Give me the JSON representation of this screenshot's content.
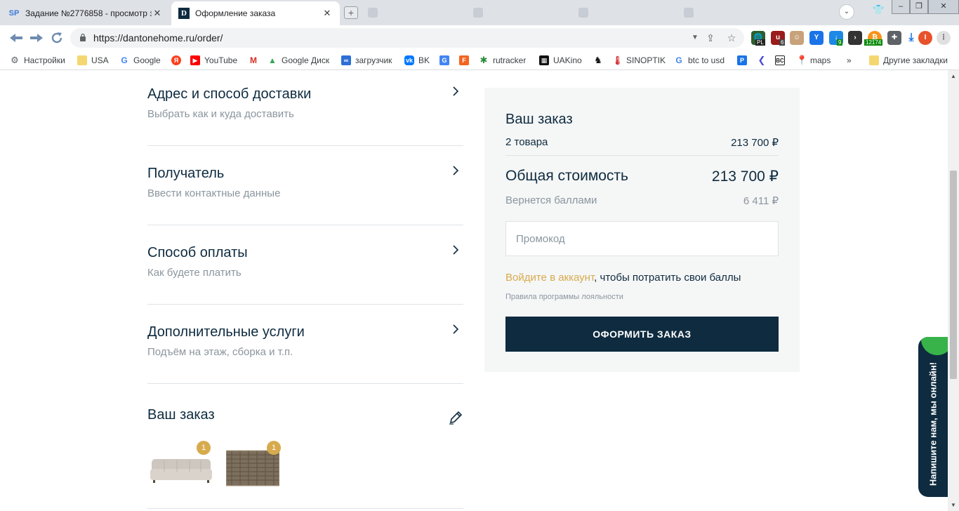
{
  "browser": {
    "tabs": [
      {
        "favicon": "SP",
        "title": "Задание №2776858 - просмотр з",
        "close": "✕"
      },
      {
        "favicon": "D",
        "title": "Оформление заказа",
        "close": "✕"
      }
    ],
    "url": "https://dantonehome.ru/order/",
    "ext_badges": {
      "pl": "PL",
      "six": "6",
      "nine": "9",
      "counter": "12174"
    },
    "bookmarks": [
      "Настройки",
      "USA",
      "Google",
      "YouTube",
      "Google Диск",
      "загрузчик",
      "BK",
      "rutracker",
      "UAKino",
      "SINOPTIK",
      "btc to usd",
      "maps",
      "Другие закладки"
    ],
    "bookmarks_more": "»"
  },
  "checkout": {
    "sections": [
      {
        "title": "Адрес и способ доставки",
        "subtitle": "Выбрать как и куда доставить"
      },
      {
        "title": "Получатель",
        "subtitle": "Ввести контактные данные"
      },
      {
        "title": "Способ оплаты",
        "subtitle": "Как будете платить"
      },
      {
        "title": "Дополнительные услуги",
        "subtitle": "Подъём на этаж, сборка и т.п."
      }
    ],
    "order": {
      "title": "Ваш заказ",
      "items": [
        {
          "icon": "sofa-thumbnail",
          "qty": "1"
        },
        {
          "icon": "rug-thumbnail",
          "qty": "1"
        }
      ]
    }
  },
  "summary": {
    "title": "Ваш заказ",
    "items_label": "2 товара",
    "items_price": "213 700 ₽",
    "total_label": "Общая стоимость",
    "total_price": "213 700 ₽",
    "bonus_label": "Вернется баллами",
    "bonus_value": "6 411 ₽",
    "promo_placeholder": "Промокод",
    "login_link": "Войдите в аккаунт",
    "login_rest": ", чтобы потратить свои баллы",
    "rules": "Правила программы лояльности",
    "checkout_button": "ОФОРМИТЬ ЗАКАЗ"
  },
  "chat_widget": {
    "label": "Напишите нам, мы онлайн!"
  },
  "colors": {
    "brand": "#0e2b3f",
    "accent": "#d7ab4d",
    "chat_leaf": "#37b34a"
  }
}
